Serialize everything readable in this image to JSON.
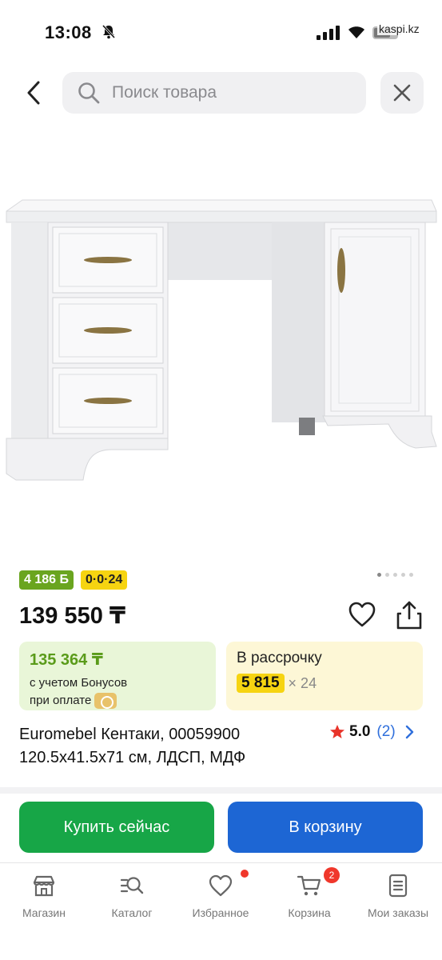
{
  "status_bar": {
    "time": "13:08",
    "domain": "kaspi.kz",
    "icons": [
      "bell-off-icon",
      "signal-icon",
      "wifi-icon",
      "battery-icon"
    ]
  },
  "search": {
    "placeholder": "Поиск товара",
    "back_icon": "chevron-left-icon",
    "close_icon": "close-icon"
  },
  "gallery": {
    "page_count": 5,
    "active_page": 1
  },
  "badges": {
    "bonus": "4 186 Б",
    "installment": "0·0·24"
  },
  "price": "139 550 ₸",
  "bonus_card": {
    "amount": "135 364 ₸",
    "line1": "с учетом Бонусов",
    "line2": "при оплате"
  },
  "installment_card": {
    "title": "В рассрочку",
    "amount": "5 815",
    "months": "× 24"
  },
  "product": {
    "title_line1": "Euromebel Кентаки, 00059900",
    "title_line2": "120.5x41.5x71 см, ЛДСП, МДФ",
    "rating": "5.0",
    "reviews": "(2)"
  },
  "actions": {
    "buy": "Купить сейчас",
    "cart": "В корзину"
  },
  "nav": {
    "items": [
      {
        "label": "Магазин",
        "icon": "store-icon"
      },
      {
        "label": "Каталог",
        "icon": "catalog-search-icon"
      },
      {
        "label": "Избранное",
        "icon": "heart-icon"
      },
      {
        "label": "Корзина",
        "icon": "cart-icon",
        "badge": "2"
      },
      {
        "label": "Мои заказы",
        "icon": "orders-icon"
      }
    ]
  },
  "colors": {
    "green": "#17a647",
    "blue": "#1d66d4",
    "yellow": "#f6d411",
    "bonus_green": "#6aa51f",
    "badge_red": "#f0372b"
  }
}
